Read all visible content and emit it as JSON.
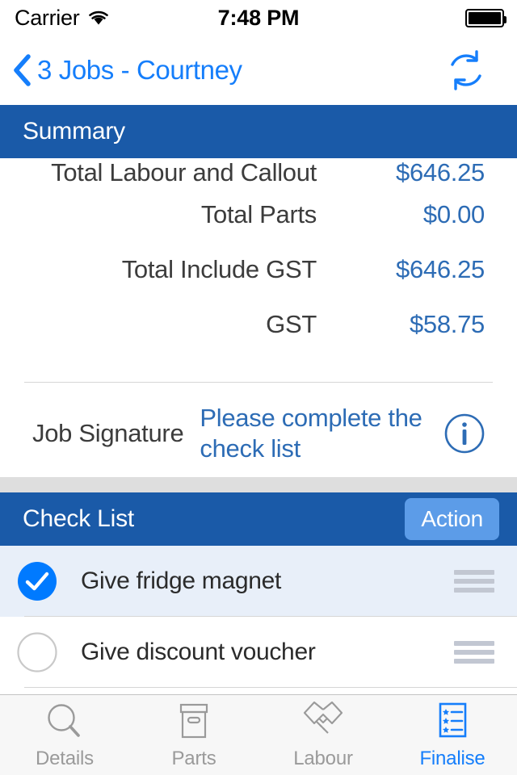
{
  "status_bar": {
    "carrier": "Carrier",
    "wifi_icon": "wifi-icon",
    "time": "7:48 PM",
    "battery_icon": "battery-full-icon"
  },
  "nav_bar": {
    "back_icon": "chevron-left-icon",
    "title": "3 Jobs - Courtney",
    "refresh_icon": "refresh-sync-icon"
  },
  "summary": {
    "header_title": "Summary",
    "rows": [
      {
        "label": "Total Labour and Callout",
        "value": "$646.25"
      },
      {
        "label": "Total Parts",
        "value": "$0.00"
      },
      {
        "label": "Total Include GST",
        "value": "$646.25"
      },
      {
        "label": "GST",
        "value": "$58.75"
      }
    ],
    "signature": {
      "label": "Job Signature",
      "value": "Please complete the check list",
      "info_icon": "info-circle-icon"
    }
  },
  "check_list": {
    "header_title": "Check List",
    "action_label": "Action",
    "items": [
      {
        "label": "Give fridge magnet",
        "checked": true,
        "handle_icon": "reorder-handle-icon"
      },
      {
        "label": "Give discount voucher",
        "checked": false,
        "handle_icon": "reorder-handle-icon"
      }
    ]
  },
  "tab_bar": {
    "tabs": [
      {
        "label": "Details",
        "icon": "magnifier-icon",
        "active": false
      },
      {
        "label": "Parts",
        "icon": "box-icon",
        "active": false
      },
      {
        "label": "Labour",
        "icon": "handshake-icon",
        "active": false
      },
      {
        "label": "Finalise",
        "icon": "checklist-document-icon",
        "active": true
      }
    ]
  },
  "colors": {
    "section_header_blue": "#1A5AA8",
    "action_button_blue": "#5C9CE8",
    "value_blue": "#2D6CB5",
    "ios_blue": "#157EFB",
    "checked_row_bg": "#E8EFF9",
    "tab_inactive": "#9A9A9A"
  }
}
